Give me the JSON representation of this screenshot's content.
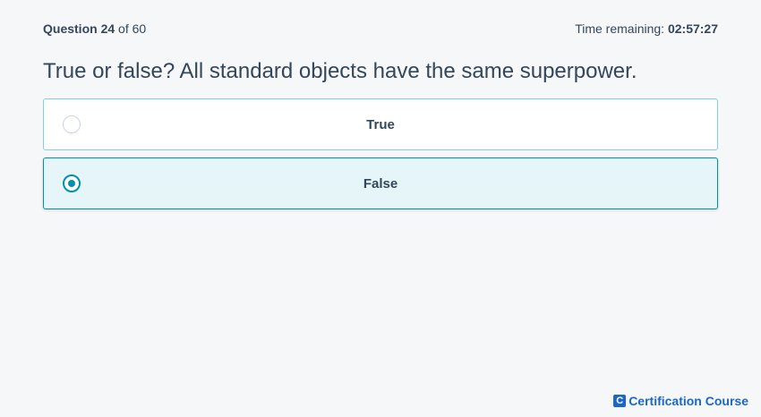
{
  "header": {
    "question_prefix": "Question",
    "question_number": "24",
    "question_of": "of 60",
    "timer_label": "Time remaining:",
    "timer_value": "02:57:27"
  },
  "question": {
    "text": "True or false? All standard objects have the same superpower."
  },
  "options": [
    {
      "label": "True",
      "selected": false
    },
    {
      "label": "False",
      "selected": true
    }
  ],
  "brand": {
    "logo_letter": "C",
    "name": "Certification Course"
  },
  "colors": {
    "accent": "#0091ae",
    "selected_bg": "#e5f5f8",
    "option_border": "#7fd1de",
    "brand": "#1a67c9"
  }
}
